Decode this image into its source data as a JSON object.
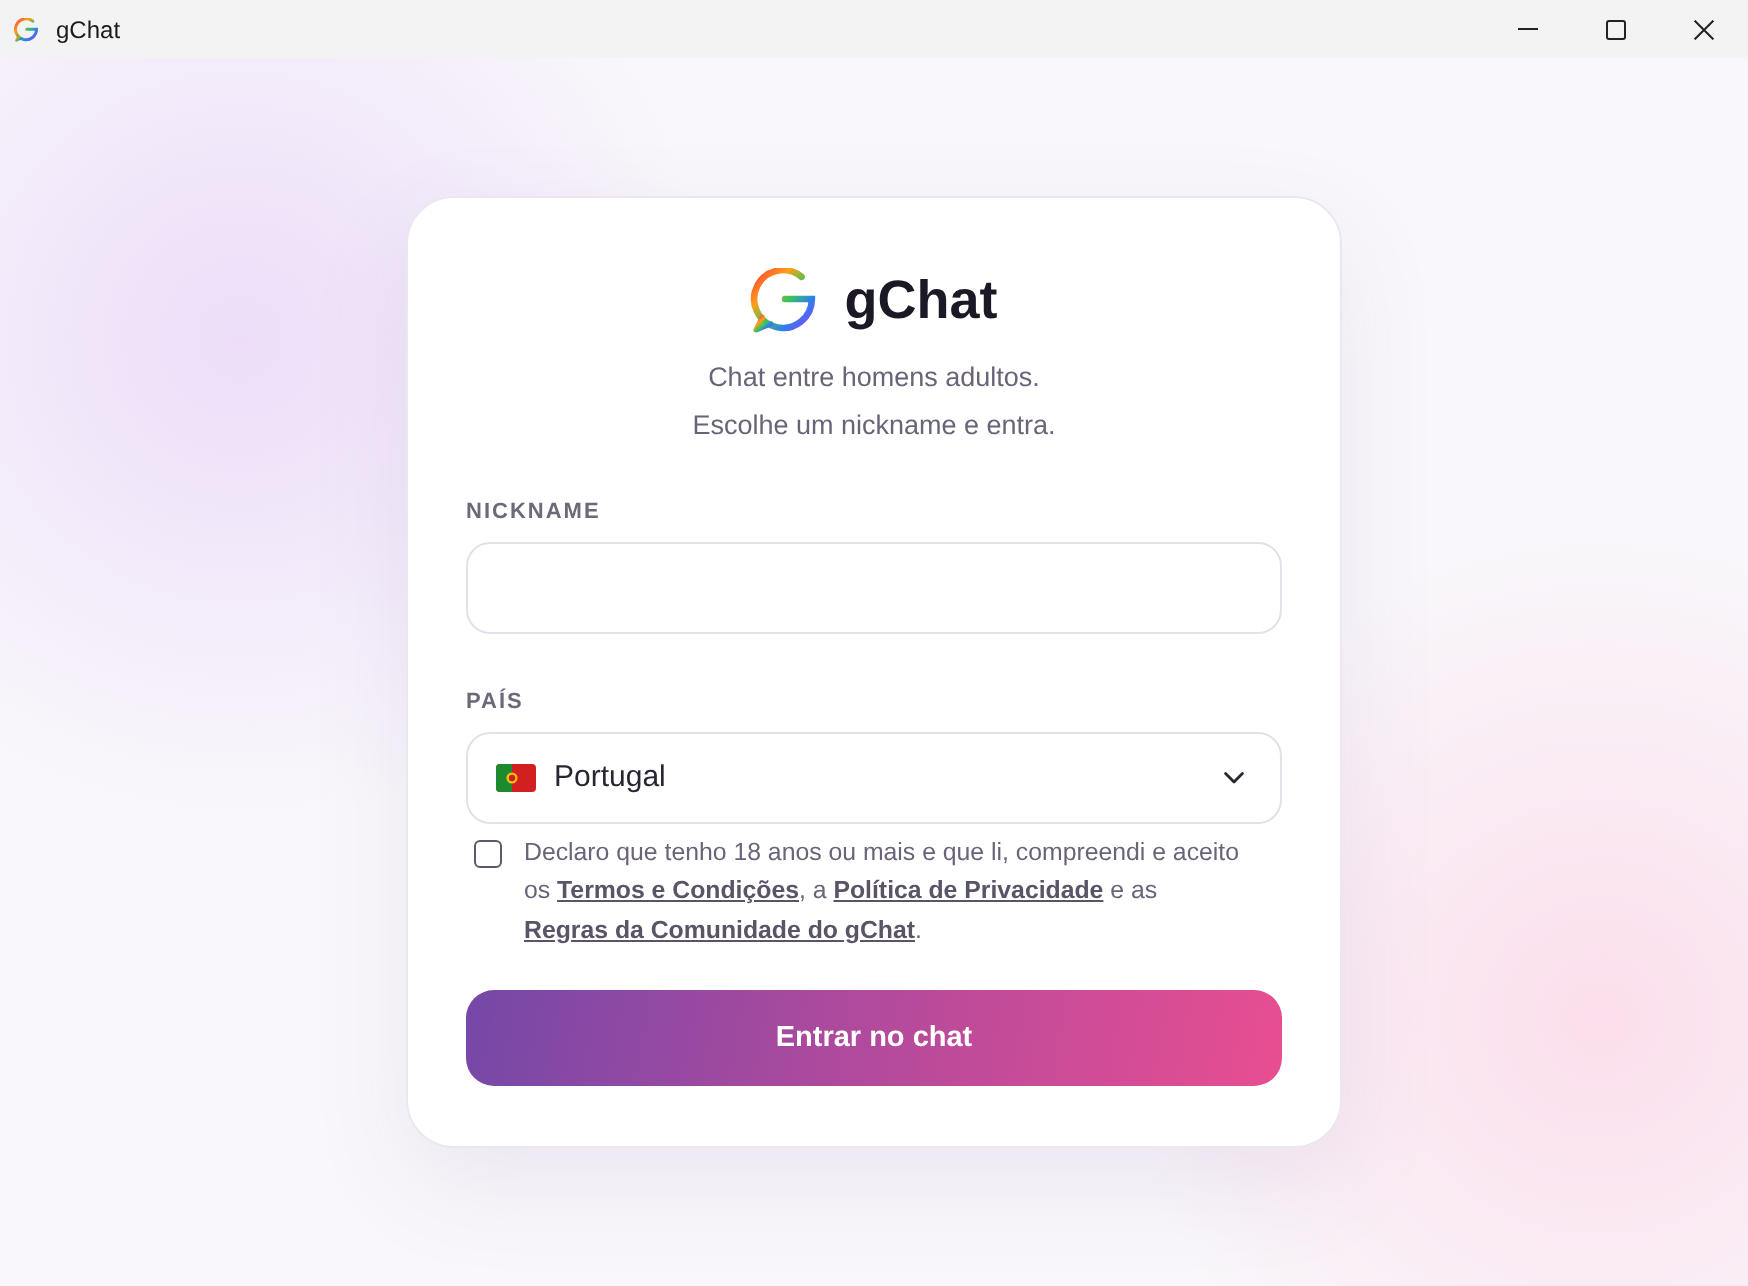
{
  "window": {
    "title": "gChat"
  },
  "brand": {
    "name": "gChat",
    "tagline": [
      "Chat entre homens adultos.",
      "Escolhe um nickname e entra."
    ]
  },
  "form": {
    "fields": [
      {
        "kind": "text",
        "label": "NICKNAME"
      },
      {
        "kind": "select",
        "label": "PAÍS",
        "value": "Portugal"
      }
    ],
    "consent": {
      "checked": false,
      "parts": [
        {
          "kind": "text",
          "text": "Declaro que tenho 18 anos ou mais e que li, compreendi e aceito os "
        },
        {
          "kind": "link",
          "text": "Termos e Condições"
        },
        {
          "kind": "text",
          "text": ", a "
        },
        {
          "kind": "link",
          "text": "Política de Privacidade"
        },
        {
          "kind": "text",
          "text": " e as "
        },
        {
          "kind": "link",
          "text": "Regras da Comunidade do gChat"
        },
        {
          "kind": "text",
          "text": "."
        }
      ]
    },
    "submit": "Entrar no chat"
  }
}
